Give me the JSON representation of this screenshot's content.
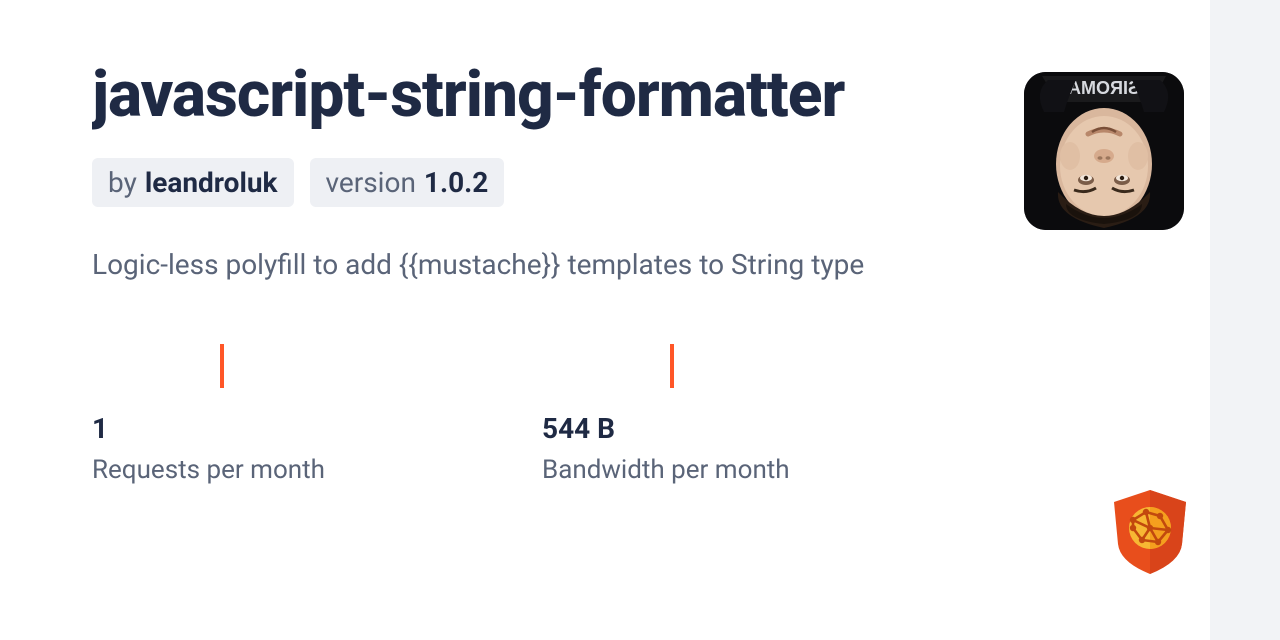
{
  "header": {
    "title": "javascript-string-formatter",
    "author_prefix": "by",
    "author": "leandroluk",
    "version_prefix": "version",
    "version": "1.0.2"
  },
  "description": "Logic-less polyfill to add {{mustache}} templates to String type",
  "stats": [
    {
      "value": "1",
      "label": "Requests per month"
    },
    {
      "value": "544 B",
      "label": "Bandwidth per month"
    }
  ],
  "colors": {
    "accent": "#ff5627",
    "text_primary": "#1f2a44",
    "text_secondary": "#5a6478",
    "chip_bg": "#eef0f4"
  }
}
